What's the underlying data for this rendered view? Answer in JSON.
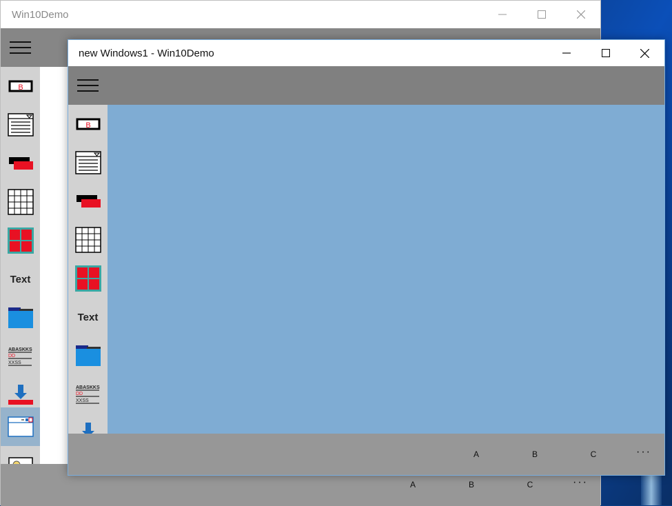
{
  "back_window": {
    "title": "Win10Demo",
    "nav_text_label": "Text",
    "commands": [
      "A",
      "B",
      "C"
    ],
    "more": "···"
  },
  "front_window": {
    "title": "new Windows1 - Win10Demo",
    "nav_text_label": "Text",
    "commands": [
      "A",
      "B",
      "C"
    ],
    "more": "···"
  },
  "list_icon_text": {
    "line1": "ABASKKS",
    "line2": "DD",
    "line3": "XXSS"
  },
  "colors": {
    "header": "#808080",
    "sidebar": "#d2d2d2",
    "content_front": "#7facd3",
    "command_bar": "#979797",
    "accent_red": "#e81123",
    "accent_blue": "#1e90e0",
    "selected_item": "#96b3cc"
  }
}
